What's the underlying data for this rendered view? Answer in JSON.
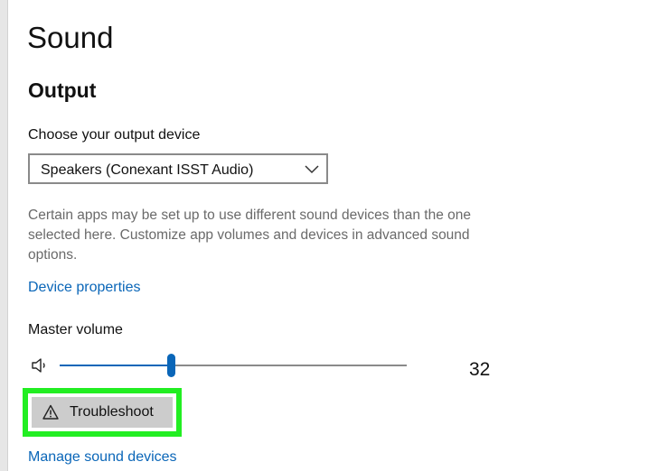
{
  "page": {
    "title": "Sound"
  },
  "output": {
    "heading": "Output",
    "device_label": "Choose your output device",
    "device_selected": "Speakers (Conexant ISST Audio)",
    "description": "Certain apps may be set up to use different sound devices than the one selected here. Customize app volumes and devices in advanced sound options.",
    "device_properties_link": "Device properties",
    "master_volume_label": "Master volume",
    "volume_value": "32",
    "volume_level_percent": 32,
    "troubleshoot_label": "Troubleshoot",
    "manage_devices_link": "Manage sound devices"
  },
  "icons": {
    "speaker": "speaker-icon",
    "chevron": "chevron-down-icon",
    "warning": "warning-icon"
  },
  "colors": {
    "accent": "#0a66b8",
    "highlight": "#22ee22",
    "button_bg": "#cccccc",
    "secondary_text": "#6a6a6a"
  }
}
